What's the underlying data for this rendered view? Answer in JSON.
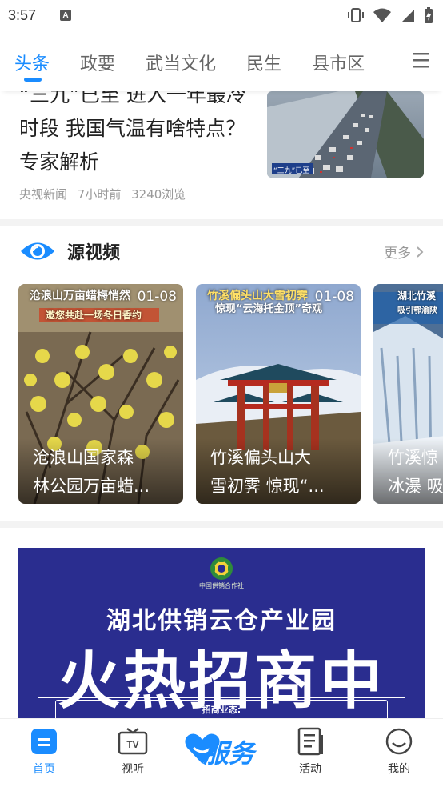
{
  "status_bar": {
    "time": "3:57",
    "a_icon": "A"
  },
  "tabs": [
    {
      "label": "头条",
      "active": true
    },
    {
      "label": "政要"
    },
    {
      "label": "武当文化"
    },
    {
      "label": "民生"
    },
    {
      "label": "县市区"
    }
  ],
  "article": {
    "title": "“三九”已至 进入一年最冷时段 我国气温有啥特点？专家解析",
    "source": "央视新闻",
    "time": "7小时前",
    "views": "3240浏览",
    "thumb_label": "“三九”已至"
  },
  "video_section": {
    "title": "源视频",
    "more": "更多",
    "cards": [
      {
        "date": "01-08",
        "overlay_top": "沧浪山万亩蜡梅悄然",
        "overlay_sub": "邀您共赴一场冬日香约",
        "line1": "沧浪山国家森",
        "line2": "林公园万亩蜡..."
      },
      {
        "date": "01-08",
        "overlay_top": "竹溪偏头山大雪初霁",
        "overlay_sub": "惊现“云海托金顶”奇观",
        "line1": "竹溪偏头山大",
        "line2": "雪初霁 惊现“..."
      },
      {
        "date": "",
        "overlay_top": "湖北竹溪",
        "overlay_sub": "吸引鄂渝陕",
        "line1": "竹溪惊",
        "line2": "冰瀑 吸"
      }
    ]
  },
  "ad": {
    "logo_text": "中国供销合作社",
    "subtitle": "湖北供销云仓产业园",
    "headline": "火热招商中",
    "biz_label": "招商业态:"
  },
  "bottom_nav": {
    "items": [
      {
        "label": "首页",
        "active": true
      },
      {
        "label": "视听"
      },
      {
        "label": "服务"
      },
      {
        "label": "活动"
      },
      {
        "label": "我的"
      }
    ]
  },
  "colors": {
    "accent": "#1a8cff",
    "ad_bg": "#2a2d8f"
  }
}
